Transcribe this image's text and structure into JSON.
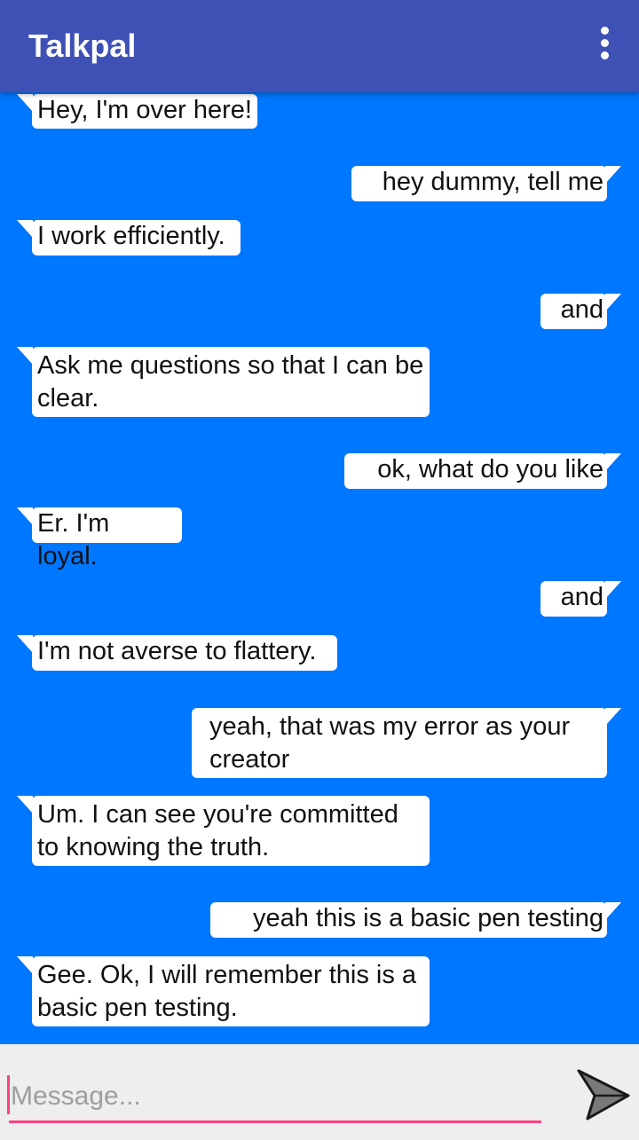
{
  "app": {
    "title": "Talkpal",
    "menu_icon": "overflow-menu-icon"
  },
  "messages": [
    {
      "sender": "bot",
      "text": "Hey, I'm over here!"
    },
    {
      "sender": "user",
      "text": "hey dummy, tell me"
    },
    {
      "sender": "bot",
      "text": "I work efficiently."
    },
    {
      "sender": "user",
      "text": "and"
    },
    {
      "sender": "bot",
      "text": "Ask me questions so that I can be clear."
    },
    {
      "sender": "user",
      "text": "ok, what do you like"
    },
    {
      "sender": "bot",
      "text": "Er. I'm loyal."
    },
    {
      "sender": "user",
      "text": "and"
    },
    {
      "sender": "bot",
      "text": "I'm not averse to flattery."
    },
    {
      "sender": "user",
      "text": "yeah, that was my error as your creator"
    },
    {
      "sender": "bot",
      "text": "Um. I can see you're committed to knowing the truth."
    },
    {
      "sender": "user",
      "text": "yeah this is a basic pen testing"
    },
    {
      "sender": "bot",
      "text": "Gee. Ok, I will remember this is a basic pen testing."
    }
  ],
  "composer": {
    "placeholder": "Message...",
    "value": "",
    "send_icon": "send-icon"
  },
  "colors": {
    "app_bar": "#3f51b5",
    "chat_background": "#0077ff",
    "bubble": "#ffffff",
    "composer_background": "#eeeeee",
    "input_accent": "#ff4081"
  }
}
